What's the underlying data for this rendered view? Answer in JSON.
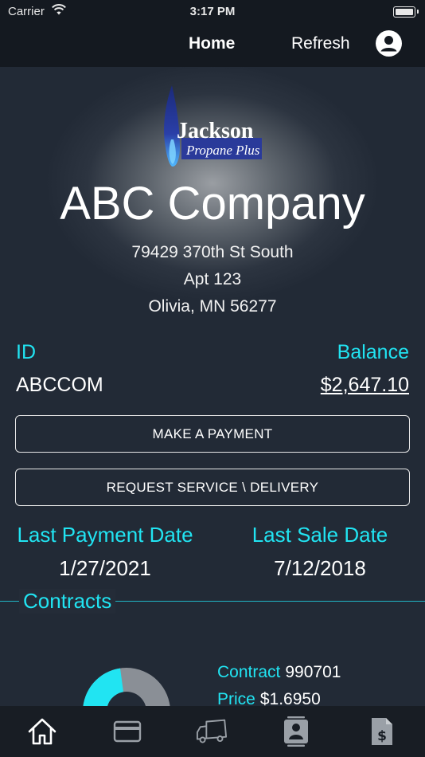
{
  "status": {
    "carrier": "Carrier",
    "time": "3:17 PM"
  },
  "nav": {
    "home": "Home",
    "refresh": "Refresh",
    "profile_icon": "person-circle-icon"
  },
  "logo": {
    "name": "Jackson",
    "tagline": "Propane Plus"
  },
  "company": {
    "name": "ABC Company",
    "address_line1": "79429 370th St South",
    "address_line2": "Apt 123",
    "address_line3": "Olivia, MN 56277"
  },
  "account": {
    "id_label": "ID",
    "id_value": "ABCCOM",
    "balance_label": "Balance",
    "balance_value": "$2,647.10"
  },
  "buttons": {
    "make_payment": "MAKE A PAYMENT",
    "request_service": "REQUEST SERVICE \\ DELIVERY"
  },
  "dates": {
    "last_payment_label": "Last Payment Date",
    "last_payment_value": "1/27/2021",
    "last_sale_label": "Last Sale Date",
    "last_sale_value": "7/12/2018"
  },
  "contracts": {
    "title": "Contracts",
    "contract_label": "Contract",
    "contract_value": "990701",
    "price_label": "Price",
    "price_value": "$1.6950"
  },
  "tabs": [
    {
      "icon": "home-icon"
    },
    {
      "icon": "credit-card-icon"
    },
    {
      "icon": "delivery-truck-icon"
    },
    {
      "icon": "contact-card-icon"
    },
    {
      "icon": "invoice-dollar-icon"
    }
  ],
  "colors": {
    "accent": "#21e4f2",
    "gauge_fill": "#21e4f2",
    "gauge_track": "#8a8f96",
    "bar": "#141920"
  }
}
